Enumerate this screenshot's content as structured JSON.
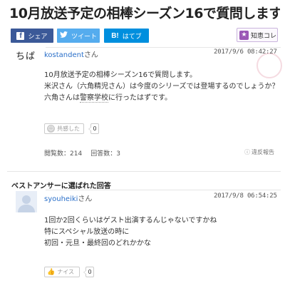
{
  "question": {
    "title": "10月放送予定の相棒シーズン16で質問します…",
    "share": {
      "facebook_label": "シェア",
      "twitter_label": "ツイート",
      "hatena_label": "はてブ",
      "facebook_icon": "f",
      "hatena_icon": "B!"
    },
    "chie_kore_label": "知恵コレ",
    "user_badge": "ちば",
    "username": "kostandent",
    "honorific": "さん",
    "date": "2017/9/6  08:42:27",
    "body": {
      "line1": "10月放送予定の相棒シーズン16で質問します。",
      "line2": "米沢さん（六角精児さん）は今度のシリーズでは登場するのでしょうか？",
      "line3_before": "六角さんは",
      "line3_link": "警察学校",
      "line3_after": "に行ったはずです。"
    },
    "empathy_label": "共感した",
    "empathy_count": "0",
    "views_label": "閲覧数：214",
    "answers_label": "回答数：3",
    "report_label": "違反報告"
  },
  "best_answer": {
    "heading": "ベストアンサーに選ばれた回答",
    "username": "syouheiki",
    "honorific": "さん",
    "date": "2017/9/8  06:54:25",
    "body": {
      "line1": "1回か2回くらいはゲスト出演するんじゃないですかね",
      "line2": "特にスペシャル放送の時に",
      "line3": "初回・元旦・最終回のどれかかな"
    },
    "nice_label": "ナイス",
    "nice_count": "0"
  },
  "colors": {
    "facebook": "#3b5998",
    "twitter": "#55acee",
    "hatena": "#008fde",
    "link": "#2a6fc9",
    "chie_purple": "#9b59b6"
  }
}
